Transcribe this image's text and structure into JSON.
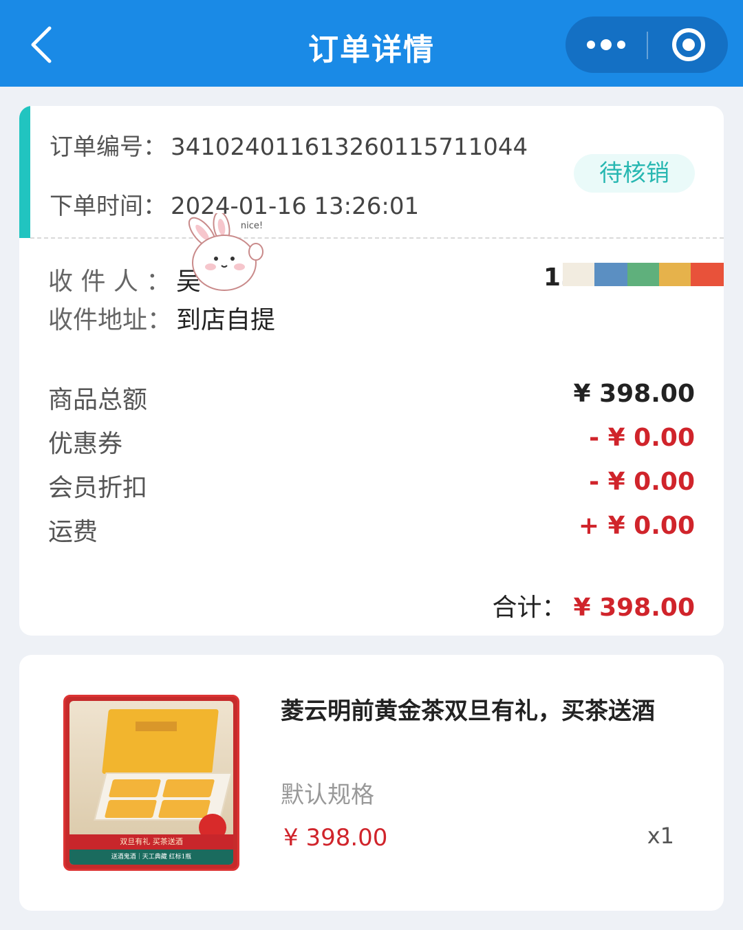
{
  "header": {
    "title": "订单详情",
    "back_icon": "chevron-left-icon",
    "more_icon": "more-dots-icon",
    "close_icon": "target-circle-icon",
    "bar_color": "#1a8ae6"
  },
  "order": {
    "number_label": "订单编号：",
    "number_value": "34102401161326011571104 4",
    "time_label": "下单时间：",
    "time_value": "2024-01-16 13:26:01",
    "status": "待核销",
    "accent_color": "#21c4c0"
  },
  "recipient": {
    "name_label": "收 件 人 ：",
    "name_value": "吴",
    "phone_prefix": "1",
    "address_label": "收件地址：",
    "address_value": "到店自提"
  },
  "sticker": {
    "text": "nice!"
  },
  "summary": {
    "rows": [
      {
        "label": "商品总额",
        "amount": "¥ 398.00",
        "tone": "dark"
      },
      {
        "label": "优惠券",
        "amount": "- ¥ 0.00",
        "tone": "red"
      },
      {
        "label": "会员折扣",
        "amount": "- ¥ 0.00",
        "tone": "red"
      },
      {
        "label": "运费",
        "amount": "+ ¥ 0.00",
        "tone": "red"
      }
    ],
    "total_label": "合计：",
    "total_amount": "¥ 398.00",
    "price_color": "#d0242b"
  },
  "product": {
    "name": "菱云明前黄金茶双旦有礼，买茶送酒",
    "spec": "默认规格",
    "price": "¥ 398.00",
    "qty": "x1",
    "image_caption": "双旦有礼 买茶送酒",
    "image_footer": "送酒鬼酒｜天工典藏 红标1瓶"
  }
}
